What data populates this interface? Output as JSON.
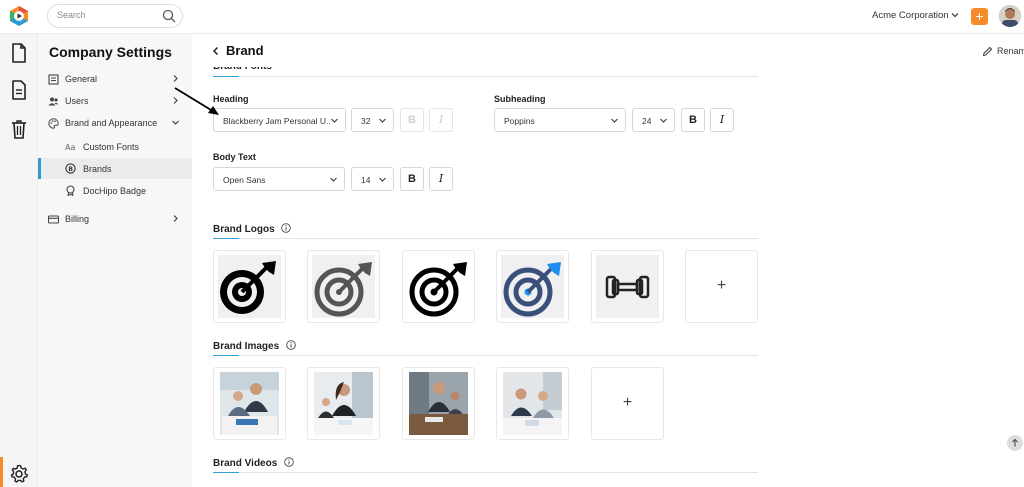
{
  "topbar": {
    "search_placeholder": "Search",
    "company": "Acme Corporation",
    "plus": "+"
  },
  "sidebar": {
    "title": "Company Settings",
    "items": [
      {
        "label": "General"
      },
      {
        "label": "Users"
      },
      {
        "label": "Brand and Appearance"
      },
      {
        "label": "Billing"
      }
    ],
    "sub_items": [
      {
        "label": "Custom Fonts"
      },
      {
        "label": "Brands"
      },
      {
        "label": "DocHipo Badge"
      }
    ]
  },
  "page": {
    "title": "Brand",
    "rename": "Rename"
  },
  "fonts": {
    "section_title": "Brand Fonts",
    "heading": {
      "label": "Heading",
      "font": "Blackberry Jam Personal U...",
      "size": "32",
      "bold": "B",
      "italic": "I"
    },
    "subheading": {
      "label": "Subheading",
      "font": "Poppins",
      "size": "24",
      "bold": "B",
      "italic": "I"
    },
    "body": {
      "label": "Body Text",
      "font": "Open Sans",
      "size": "14",
      "bold": "B",
      "italic": "I"
    }
  },
  "logos": {
    "section_title": "Brand Logos",
    "add": "+"
  },
  "images": {
    "section_title": "Brand Images",
    "add": "+"
  },
  "videos": {
    "section_title": "Brand Videos"
  },
  "colors": {
    "accent_orange": "#f58b2b",
    "accent_blue": "#2c9cd6",
    "logo_blue": "#1e8ff0",
    "logo_navy": "#3a4f7a"
  }
}
